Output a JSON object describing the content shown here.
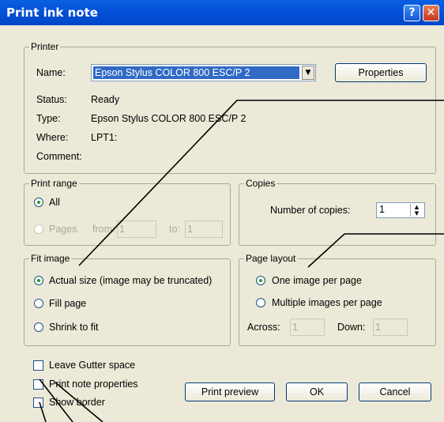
{
  "window": {
    "title": "Print ink note"
  },
  "printer": {
    "legend": "Printer",
    "name_label": "Name:",
    "name_value": "Epson Stylus COLOR 800 ESC/P 2",
    "properties_button": "Properties",
    "status_label": "Status:",
    "status_value": "Ready",
    "type_label": "Type:",
    "type_value": "Epson Stylus COLOR 800 ESC/P 2",
    "where_label": "Where:",
    "where_value": "LPT1:",
    "comment_label": "Comment:"
  },
  "print_range": {
    "legend": "Print range",
    "all_label": "All",
    "pages_label": "Pages",
    "from_label": "from:",
    "from_value": "1",
    "to_label": "to:",
    "to_value": "1",
    "selected": "All"
  },
  "copies": {
    "legend": "Copies",
    "number_label": "Number of copies:",
    "number_value": "1"
  },
  "fit_image": {
    "legend": "Fit image",
    "options": [
      "Actual size (image may be truncated)",
      "Fill page",
      "Shrink to fit"
    ],
    "selected": "Actual size (image may be truncated)"
  },
  "page_layout": {
    "legend": "Page layout",
    "options": [
      "One image per page",
      "Multiple images per page"
    ],
    "selected": "One image per page",
    "across_label": "Across:",
    "across_value": "1",
    "down_label": "Down:",
    "down_value": "1"
  },
  "checkboxes": {
    "gutter": "Leave Gutter space",
    "note_properties": "Print note properties",
    "border": "Show border"
  },
  "buttons": {
    "preview": "Print preview",
    "ok": "OK",
    "cancel": "Cancel"
  },
  "colors": {
    "titlebar": "#0351d8",
    "dialog": "#ece9d8",
    "selection": "#316ac5"
  }
}
